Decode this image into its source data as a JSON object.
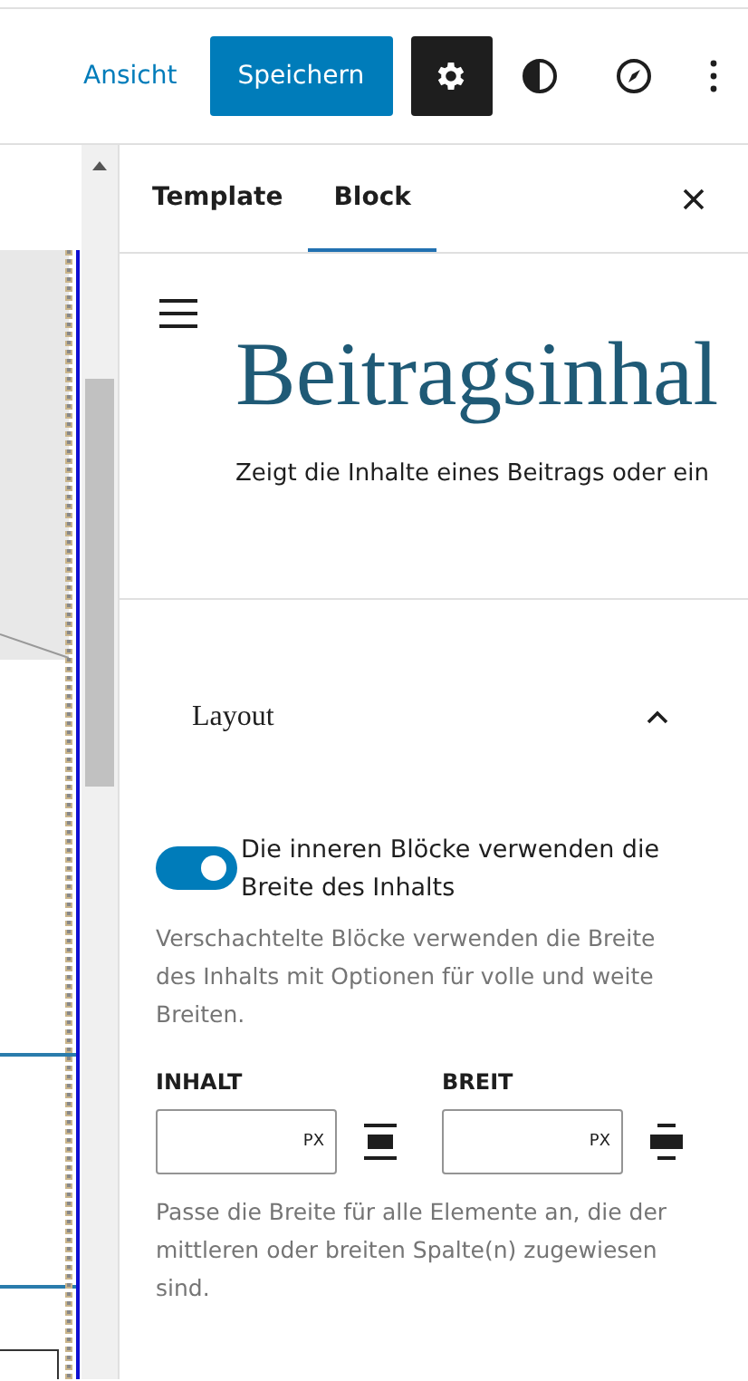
{
  "toolbar": {
    "view_link": "Ansicht",
    "save_button": "Speichern",
    "settings_active": true
  },
  "sidebar": {
    "tabs": [
      {
        "label": "Template",
        "selected": false
      },
      {
        "label": "Block",
        "selected": true
      }
    ],
    "block_card": {
      "title": "Beitragsinhal",
      "description": "Zeigt die Inhalte eines Beitrags oder ein"
    },
    "layout_panel": {
      "title": "Layout",
      "expanded": true,
      "toggle": {
        "label": "Die inneren Blöcke verwenden die Breite des Inhalts",
        "on": true
      },
      "toggle_help": "Verschachtelte Blöcke verwenden die Breite des Inhalts mit Optionen für volle und weite Breiten.",
      "fields": [
        {
          "label": "INHALT",
          "unit": "PX",
          "kind": "content"
        },
        {
          "label": "BREIT",
          "unit": "PX",
          "kind": "wide"
        }
      ],
      "help": "Passe die Breite für alle Elemente an, die der mittleren oder breiten Spalte(n) zugewiesen sind."
    }
  }
}
